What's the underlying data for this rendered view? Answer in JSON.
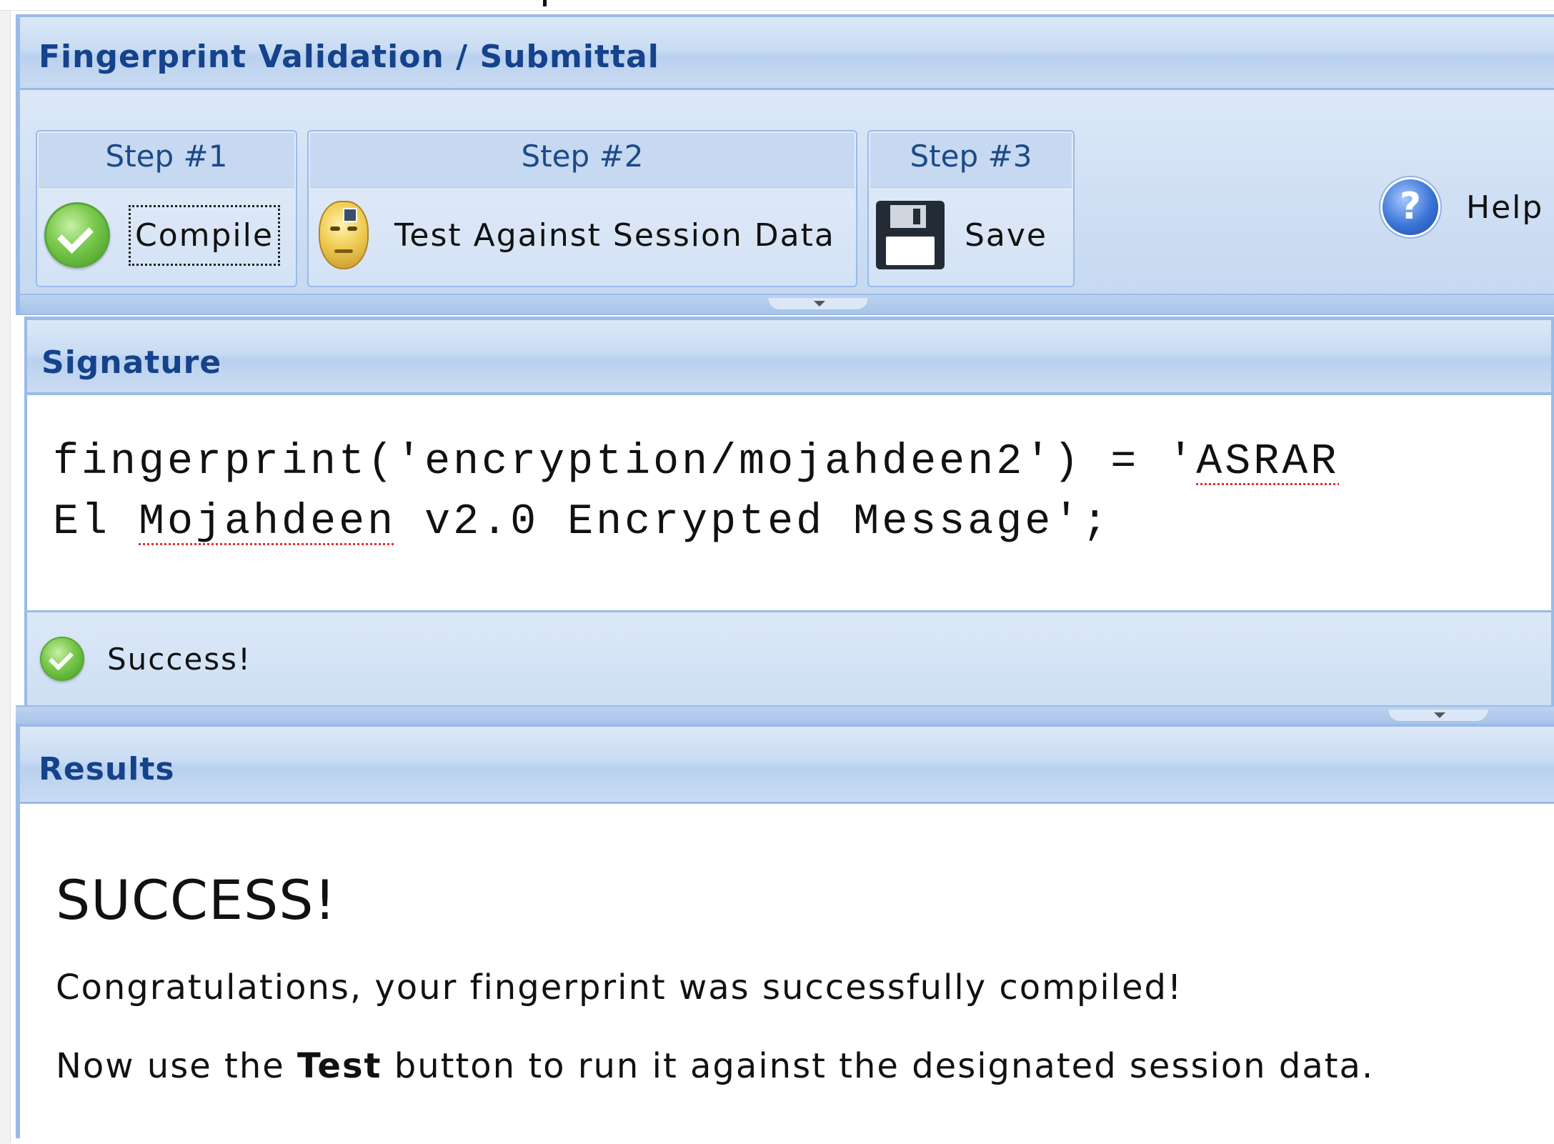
{
  "window": {
    "title": "Fingerprint Validation / Submittal"
  },
  "toolbar": {
    "steps": [
      {
        "label": "Step #1",
        "button": "Compile",
        "icon": "check-circle-icon"
      },
      {
        "label": "Step #2",
        "button": "Test Against Session Data",
        "icon": "robot-head-icon"
      },
      {
        "label": "Step #3",
        "button": "Save",
        "icon": "floppy-disk-icon"
      }
    ],
    "help": {
      "label": "Help",
      "icon": "question-circle-icon"
    }
  },
  "signature": {
    "title": "Signature",
    "code_line1_a": "fingerprint('encryption/mojahdeen2') = '",
    "code_line1_b": "ASRAR",
    "code_line2_a": "El ",
    "code_line2_b": "Mojahdeen",
    "code_line2_c": " v2.0 Encrypted Message';",
    "status": "Success!"
  },
  "results": {
    "title": "Results",
    "heading": "SUCCESS!",
    "message1": "Congratulations, your fingerprint was successfully compiled!",
    "message2_prefix": "Now use the ",
    "message2_bold": "Test",
    "message2_suffix": " button to run it against the designated session data."
  },
  "colors": {
    "header_text": "#15428b",
    "border": "#99bbe8",
    "panel_bg": "#dce8f7",
    "success_green": "#5aa63a"
  }
}
